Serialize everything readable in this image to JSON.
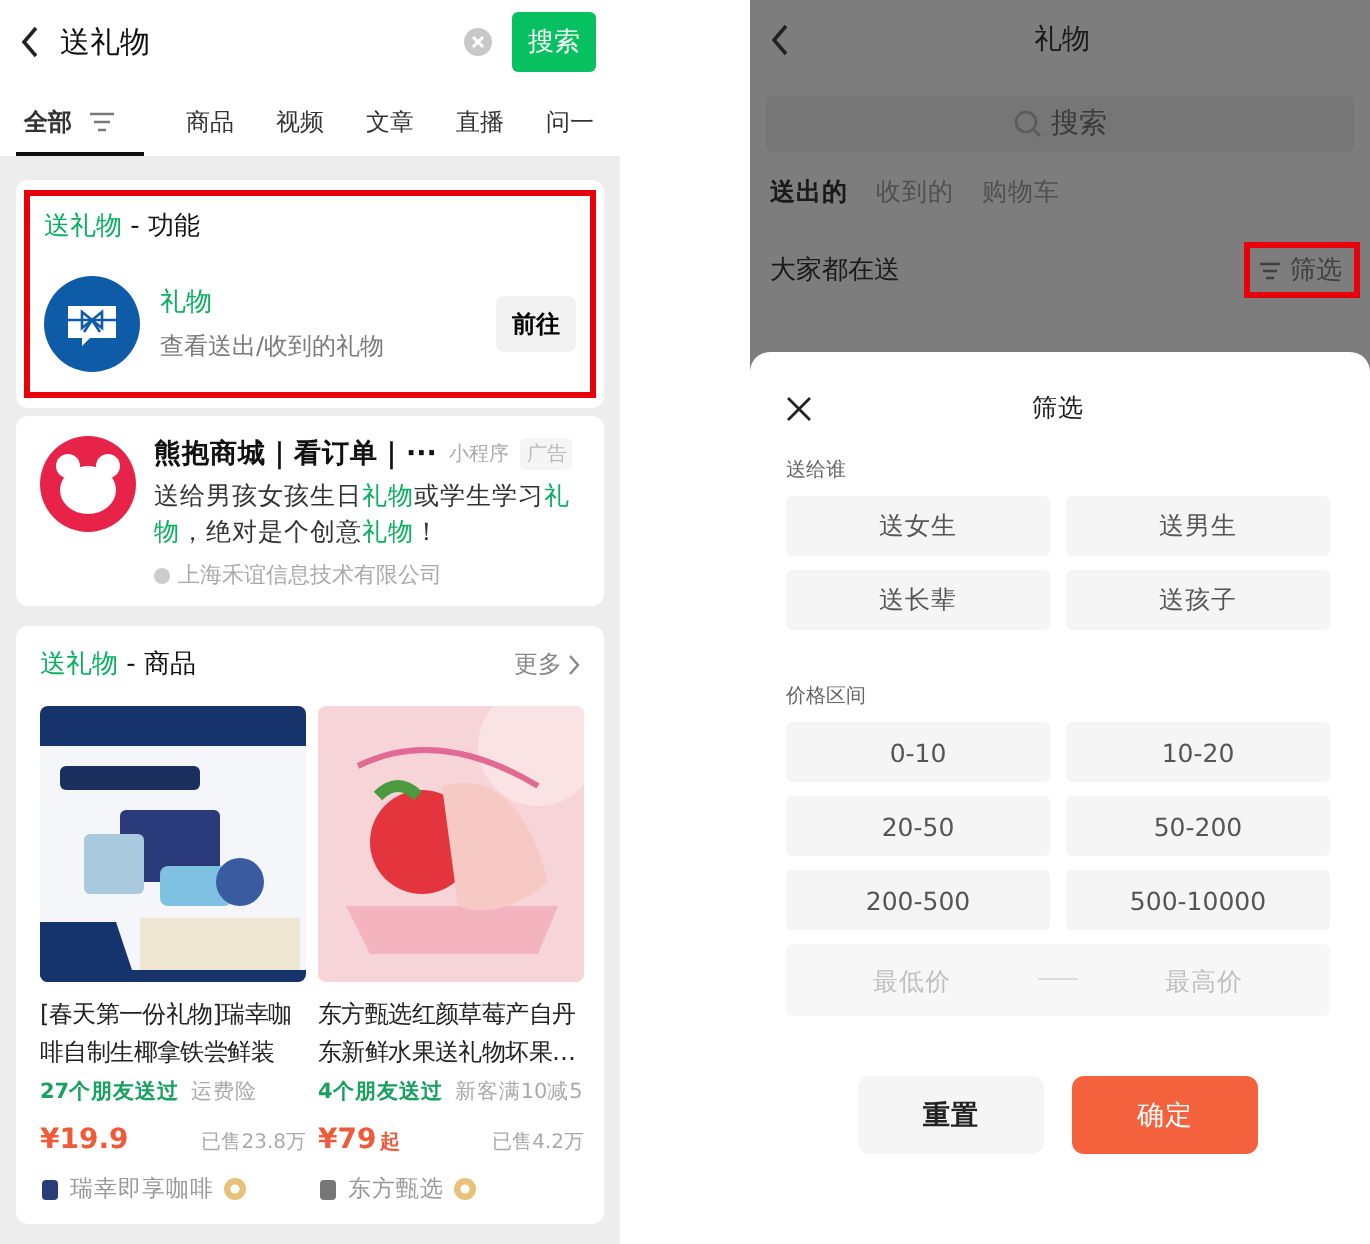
{
  "left_screen": {
    "search_bar": {
      "query": "送礼物",
      "button": "搜索"
    },
    "tabs": [
      {
        "label": "全部",
        "selected": true,
        "has_filter": true
      },
      {
        "label": "商品",
        "selected": false
      },
      {
        "label": "视频",
        "selected": false
      },
      {
        "label": "文章",
        "selected": false
      },
      {
        "label": "直播",
        "selected": false
      },
      {
        "label": "问一",
        "selected": false
      }
    ],
    "function_card": {
      "heading": "**送礼物** - 功能",
      "highlighted": true,
      "name": "礼物",
      "description": "查看送出/收到的礼物",
      "button": "前往"
    },
    "ad_card": {
      "name": "熊抱商城｜看订单｜···",
      "type": "小程序",
      "badge": "广告",
      "description": "送给男孩女孩生日**礼物**或学生学习**礼物**，绝对是个创意**礼物**！",
      "company": "上海禾谊信息技术有限公司"
    },
    "products_section": {
      "heading": "**送礼物** - 商品",
      "more": "更多",
      "products": [
        {
          "title": "[春天第一份礼物]瑞幸咖啡自制生椰拿铁尝鲜装",
          "friends": "27个朋友送过",
          "tag": "运费险",
          "price": "¥19.9",
          "sold": "已售23.8万",
          "shop": "瑞幸即享咖啡"
        },
        {
          "title": "东方甄选红颜草莓产自丹东新鲜水果送礼物坏果…",
          "friends": "4个朋友送过",
          "tag": "新客满10减5",
          "price": "¥79",
          "price_suffix": "起",
          "sold": "已售4.2万",
          "shop": "东方甄选"
        }
      ]
    }
  },
  "right_screen": {
    "title": "礼物",
    "search": {
      "placeholder": "搜索"
    },
    "tabs": [
      {
        "label": "送出的",
        "selected": true
      },
      {
        "label": "收到的",
        "selected": false
      },
      {
        "label": "购物车",
        "selected": false
      }
    ],
    "section_title": "大家都在送",
    "filter": {
      "label": "筛选",
      "highlighted": true
    },
    "filter_sheet": {
      "title": "筛选",
      "groups": [
        {
          "label": "送给谁",
          "options": [
            {
              "label": "送女生",
              "selected": false
            },
            {
              "label": "送男生",
              "selected": false
            },
            {
              "label": "送长辈",
              "selected": false
            },
            {
              "label": "送孩子",
              "selected": false
            }
          ]
        },
        {
          "label": "价格区间",
          "options": [
            {
              "label": "0-10",
              "selected": false
            },
            {
              "label": "10-20",
              "selected": false
            },
            {
              "label": "20-50",
              "selected": false
            },
            {
              "label": "50-200",
              "selected": false
            },
            {
              "label": "200-500",
              "selected": false
            },
            {
              "label": "500-10000",
              "selected": false
            }
          ]
        }
      ],
      "min_price": {
        "placeholder": "最低价"
      },
      "max_price": {
        "placeholder": "最高价"
      },
      "buttons": [
        {
          "label": "重置",
          "kind": "secondary"
        },
        {
          "label": "确定",
          "kind": "primary"
        }
      ]
    }
  }
}
